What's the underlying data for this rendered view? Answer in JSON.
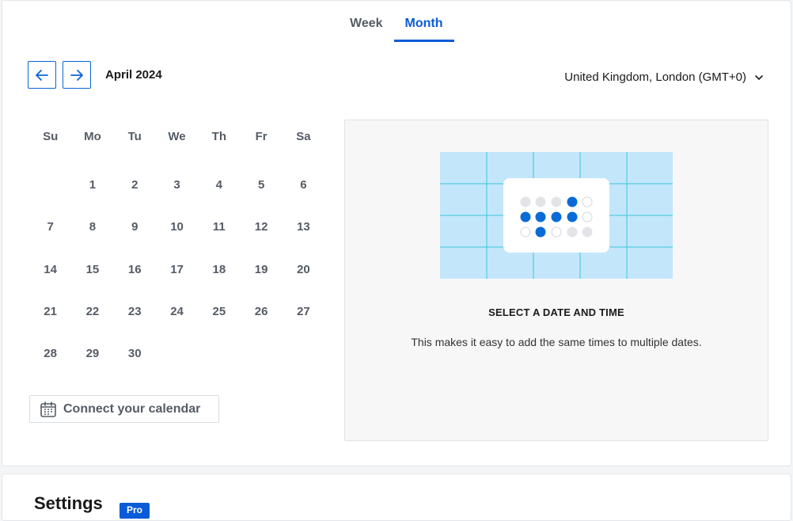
{
  "tabs": [
    {
      "label": "Week",
      "active": false
    },
    {
      "label": "Month",
      "active": true
    }
  ],
  "calendar": {
    "month_label": "April 2024",
    "days_of_week": [
      "Su",
      "Mo",
      "Tu",
      "We",
      "Th",
      "Fr",
      "Sa"
    ],
    "weeks": [
      [
        "",
        "1",
        "2",
        "3",
        "4",
        "5",
        "6"
      ],
      [
        "7",
        "8",
        "9",
        "10",
        "11",
        "12",
        "13"
      ],
      [
        "14",
        "15",
        "16",
        "17",
        "18",
        "19",
        "20"
      ],
      [
        "21",
        "22",
        "23",
        "24",
        "25",
        "26",
        "27"
      ],
      [
        "28",
        "29",
        "30",
        "",
        "",
        "",
        ""
      ]
    ]
  },
  "timezone": {
    "label": "United Kingdom, London (GMT+0)",
    "icon": "chevron-down-icon"
  },
  "connect_calendar": {
    "label": "Connect your calendar",
    "icon": "calendar-icon"
  },
  "empty_state": {
    "title": "SELECT A DATE AND TIME",
    "description": "This makes it easy to add the same times to multiple dates."
  },
  "settings": {
    "title": "Settings",
    "badge": "Pro"
  },
  "colors": {
    "accent": "#0a5bd8",
    "illustration_bg": "#c3e6fb",
    "illustration_grid": "#3cc7d8"
  }
}
